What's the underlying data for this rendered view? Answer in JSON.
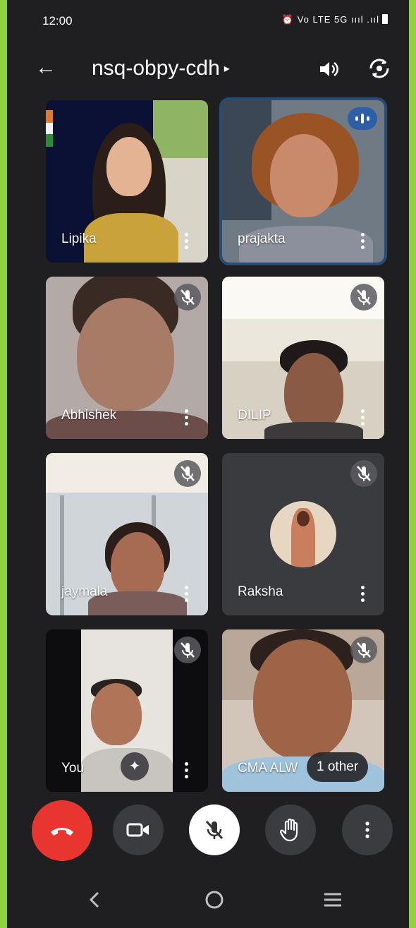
{
  "status": {
    "time": "12:00",
    "icons_text": "⏰ Vo LTE 5G ıııl .ııl"
  },
  "header": {
    "meeting_code": "nsq-obpy-cdh",
    "caret": "▸"
  },
  "participants": [
    {
      "name": "Lipika",
      "muted": false,
      "speaking": false
    },
    {
      "name": "prajakta",
      "muted": false,
      "speaking": true
    },
    {
      "name": "Abhishek",
      "muted": true,
      "speaking": false
    },
    {
      "name": "DILIP",
      "muted": true,
      "speaking": false
    },
    {
      "name": "jaymala",
      "muted": true,
      "speaking": false
    },
    {
      "name": "Raksha",
      "muted": true,
      "speaking": false
    },
    {
      "name": "You",
      "muted": true,
      "speaking": false
    },
    {
      "name": "CMA ALW",
      "muted": true,
      "speaking": false
    }
  ],
  "others_badge": "1 other",
  "colors": {
    "end_call": "#e9352f",
    "active_border": "#294b74",
    "background": "#1f1f22"
  },
  "controls": [
    "end-call",
    "camera",
    "microphone-muted",
    "raise-hand",
    "more-options"
  ],
  "navigation": [
    "back",
    "home",
    "recents"
  ]
}
